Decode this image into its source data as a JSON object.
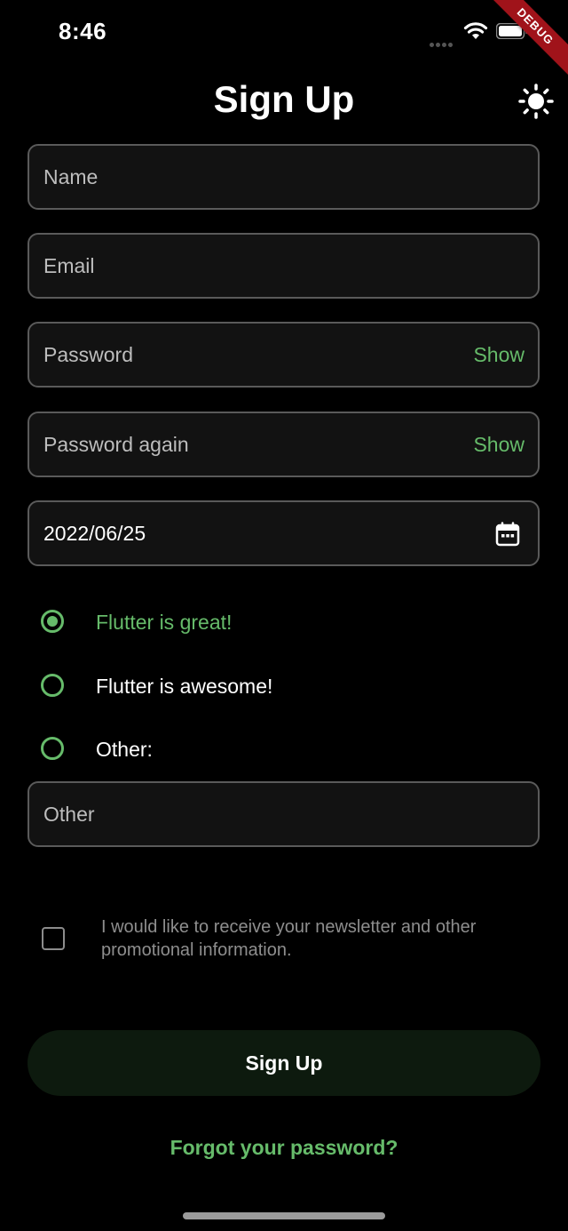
{
  "status_bar": {
    "time": "8:46",
    "debug_label": "DEBUG"
  },
  "header": {
    "title": "Sign Up",
    "theme_icon": "sun-icon"
  },
  "form": {
    "name": {
      "placeholder": "Name"
    },
    "email": {
      "placeholder": "Email"
    },
    "password": {
      "placeholder": "Password",
      "toggle_label": "Show"
    },
    "password_again": {
      "placeholder": "Password again",
      "toggle_label": "Show"
    },
    "date": {
      "value": "2022/06/25",
      "icon": "calendar-icon"
    },
    "radio_options": [
      {
        "label": "Flutter is great!",
        "selected": true
      },
      {
        "label": "Flutter is awesome!",
        "selected": false
      },
      {
        "label": "Other:",
        "selected": false
      }
    ],
    "other": {
      "placeholder": "Other"
    },
    "newsletter": {
      "label": "I would like to receive your newsletter and other promotional information.",
      "checked": false
    },
    "submit_label": "Sign Up",
    "forgot_label": "Forgot your password?"
  },
  "colors": {
    "accent": "#66bb6a",
    "background": "#000000",
    "field_border": "#5a5a5a",
    "debug_ribbon": "#a0131a"
  }
}
